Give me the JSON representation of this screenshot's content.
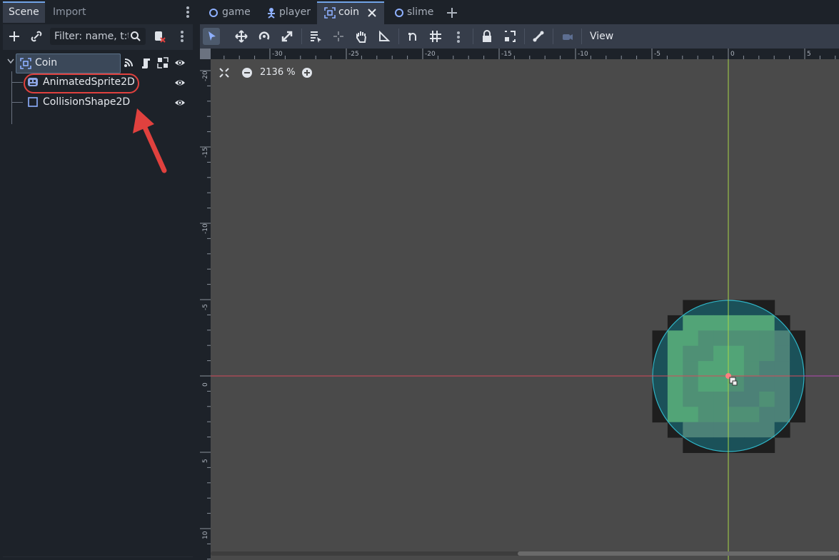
{
  "dock": {
    "tabs": [
      "Scene",
      "Import"
    ],
    "filter_placeholder": "Filter: name, t:t",
    "tree": {
      "root": {
        "label": "Coin",
        "icon": "node2d-icon"
      },
      "children": [
        {
          "label": "AnimatedSprite2D",
          "icon": "animated-sprite-icon"
        },
        {
          "label": "CollisionShape2D",
          "icon": "collision-shape-icon"
        }
      ]
    }
  },
  "scene_tabs": [
    {
      "label": "game",
      "icon": "circle-icon"
    },
    {
      "label": "player",
      "icon": "character-icon"
    },
    {
      "label": "coin",
      "icon": "node2d-icon",
      "active": true
    },
    {
      "label": "slime",
      "icon": "circle-icon"
    }
  ],
  "toolbar": {
    "view_label": "View"
  },
  "viewport": {
    "zoom_label": "2136 %",
    "ruler_top": [
      "-30",
      "-25",
      "-20",
      "-15",
      "-10",
      "-5",
      "0",
      "5"
    ],
    "ruler_left": [
      "-20",
      "-15",
      "-10",
      "-5",
      "0",
      "5",
      "10"
    ]
  },
  "colors": {
    "accent": "#70a4e8",
    "highlight_annotation": "#e0413e",
    "y_axis": "#a8d648",
    "x_axis": "#d44a5a",
    "collision": "#1a7b8a"
  }
}
